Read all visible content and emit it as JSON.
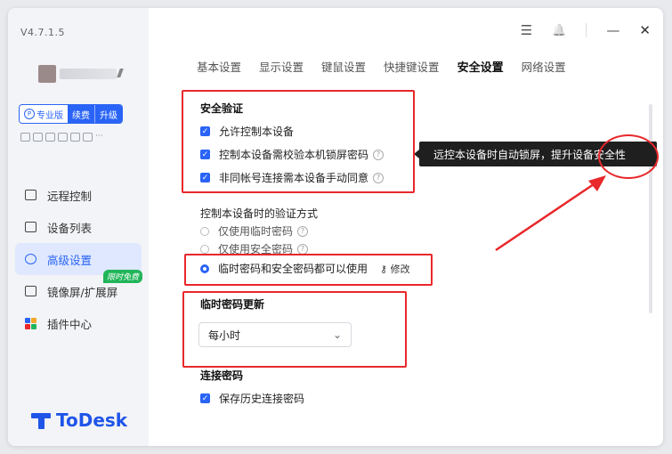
{
  "app": {
    "version": "V4.7.1.5",
    "logo_text": "ToDesk"
  },
  "account": {
    "plan_label": "专业版",
    "renew_label": "续费",
    "upgrade_label": "升级",
    "plan_icon_letter": "P",
    "more_glyph": "···"
  },
  "sidebar": {
    "items": [
      {
        "label": "远程控制",
        "icon": "remote-control-icon"
      },
      {
        "label": "设备列表",
        "icon": "device-list-icon"
      },
      {
        "label": "高级设置",
        "icon": "advanced-settings-icon",
        "active": true
      },
      {
        "label": "镜像屏/扩展屏",
        "icon": "mirror-screen-icon",
        "badge": "限时免费"
      },
      {
        "label": "插件中心",
        "icon": "plugin-center-icon"
      }
    ]
  },
  "titlebar": {
    "menu_glyph": "☰",
    "bell_glyph": "🔔",
    "minimize_glyph": "—",
    "close_glyph": "✕"
  },
  "tabs": [
    "基本设置",
    "显示设置",
    "键鼠设置",
    "快捷键设置",
    "安全设置",
    "网络设置"
  ],
  "security_verify": {
    "title": "安全验证",
    "options": [
      {
        "label": "允许控制本设备",
        "checked": true
      },
      {
        "label": "控制本设备需校验本机锁屏密码",
        "checked": true,
        "help": true
      },
      {
        "label": "非同帐号连接需本设备手动同意",
        "checked": true,
        "help": true
      }
    ],
    "tooltip": "远控本设备时自动锁屏，提升设备安全性"
  },
  "verify_method": {
    "title": "控制本设备时的验证方式",
    "options": [
      {
        "label": "仅使用临时密码",
        "selected": false,
        "help": true
      },
      {
        "label": "仅使用安全密码",
        "selected": false,
        "help": true
      },
      {
        "label": "临时密码和安全密码都可以使用",
        "selected": true
      }
    ],
    "edit_label": "修改",
    "edit_glyph": "⚷"
  },
  "temp_password": {
    "title": "临时密码更新",
    "selected": "每小时",
    "caret": "⌄"
  },
  "connect_password": {
    "title": "连接密码",
    "option": "保存历史连接密码",
    "checked": true
  },
  "glyphs": {
    "check": "✓",
    "help": "?"
  },
  "colors": {
    "accent": "#2a64f6",
    "annotation_red": "#e8282b",
    "badge_green": "#21b559"
  }
}
